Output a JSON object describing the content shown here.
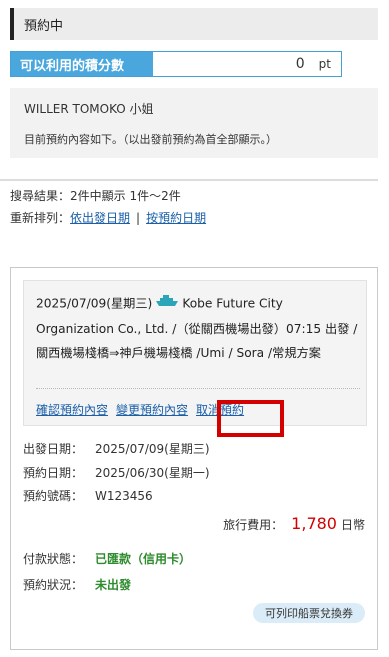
{
  "header": {
    "title": "預約中"
  },
  "points": {
    "label": "可以利用的積分數",
    "value": "0",
    "unit": "pt"
  },
  "user": {
    "name": "WILLER TOMOKO 小姐",
    "desc": "目前預約內容如下。（以出發前預約為首全部顯示。）"
  },
  "results": {
    "text": "搜尋結果：2件中顯示 1件～2件"
  },
  "sort": {
    "label": "重新排列：",
    "by_departure": "依出發日期",
    "by_booking": "按預約日期"
  },
  "reservation": {
    "date_line": "2025/07/09(星期三)",
    "company": "Kobe Future City Organization Co., Ltd. /（從關西機場出發）07:15 出發 /關西機場棧橋⇒神戶機場棧橋 /Umi / Sora /常規方案",
    "links": {
      "confirm": "確認預約內容",
      "change": "變更預約內容",
      "cancel": "取消預約"
    },
    "departure_label": "出發日期：",
    "departure_value": "2025/07/09(星期三)",
    "booking_label": "預約日期：",
    "booking_value": "2025/06/30(星期一)",
    "number_label": "預約號碼：",
    "number_value": "W123456",
    "fee_label": "旅行費用：",
    "fee_value": "1,780",
    "fee_unit": "日幣",
    "payment_label": "付款狀態：",
    "payment_value": "已匯款（信用卡）",
    "status_label": "預約狀況：",
    "status_value": "未出發",
    "badge": "可列印船票兌換券"
  },
  "colors": {
    "accent": "#4aa7de",
    "link": "#1a5fa8",
    "highlight": "#d40000",
    "paid": "#2e8b2e"
  }
}
